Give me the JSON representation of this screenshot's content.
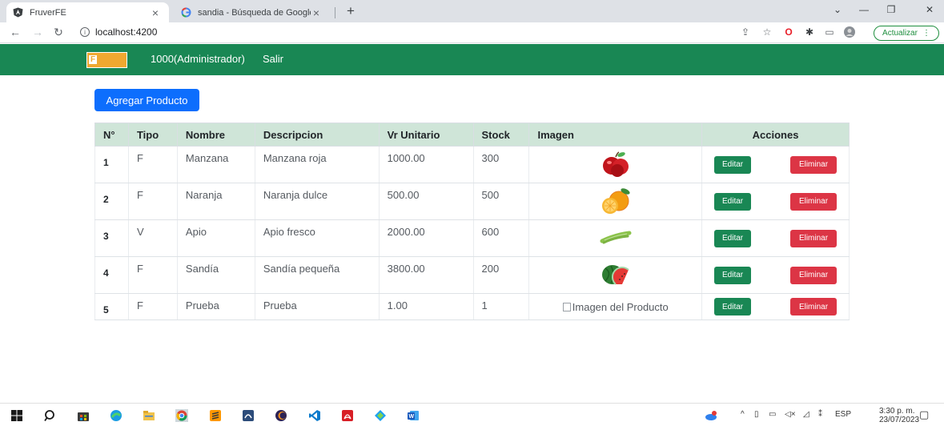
{
  "browser": {
    "tabs": [
      {
        "title": "FruverFE",
        "icon": "angular-icon",
        "active": true
      },
      {
        "title": "sandia - Búsqueda de Google",
        "icon": "google-icon",
        "active": false
      }
    ],
    "close_glyph": "×",
    "new_tab_glyph": "+",
    "window_controls": [
      "⌄",
      "—",
      "❐",
      "✕"
    ],
    "address": "localhost:4200",
    "update_label": "Actualizar",
    "update_menu_glyph": "⋮"
  },
  "navbar": {
    "logo_text": "F",
    "user_label": "1000(Administrador)",
    "logout_label": "Salir",
    "color": "#198754"
  },
  "actions": {
    "add_product_label": "Agregar Producto"
  },
  "table": {
    "headers": [
      "N°",
      "Tipo",
      "Nombre",
      "Descripcion",
      "Vr Unitario",
      "Stock",
      "Imagen",
      "Acciones"
    ],
    "rows": [
      {
        "n": "1",
        "tipo": "F",
        "nombre": "Manzana",
        "descripcion": "Manzana roja",
        "valor": "1000.00",
        "stock": "300",
        "image": "apple"
      },
      {
        "n": "2",
        "tipo": "F",
        "nombre": "Naranja",
        "descripcion": "Naranja dulce",
        "valor": "500.00",
        "stock": "500",
        "image": "orange"
      },
      {
        "n": "3",
        "tipo": "V",
        "nombre": "Apio",
        "descripcion": "Apio fresco",
        "valor": "2000.00",
        "stock": "600",
        "image": "celery"
      },
      {
        "n": "4",
        "tipo": "F",
        "nombre": "Sandía",
        "descripcion": "Sandía pequeña",
        "valor": "3800.00",
        "stock": "200",
        "image": "watermelon"
      },
      {
        "n": "5",
        "tipo": "F",
        "nombre": "Prueba",
        "descripcion": "Prueba",
        "valor": "1.00",
        "stock": "1",
        "image": "broken",
        "image_alt": "Imagen del Producto"
      }
    ],
    "edit_label": "Editar",
    "delete_label": "Eliminar"
  },
  "taskbar": {
    "language": "ESP",
    "time": "3:30 p. m.",
    "date": "23/07/2023"
  }
}
